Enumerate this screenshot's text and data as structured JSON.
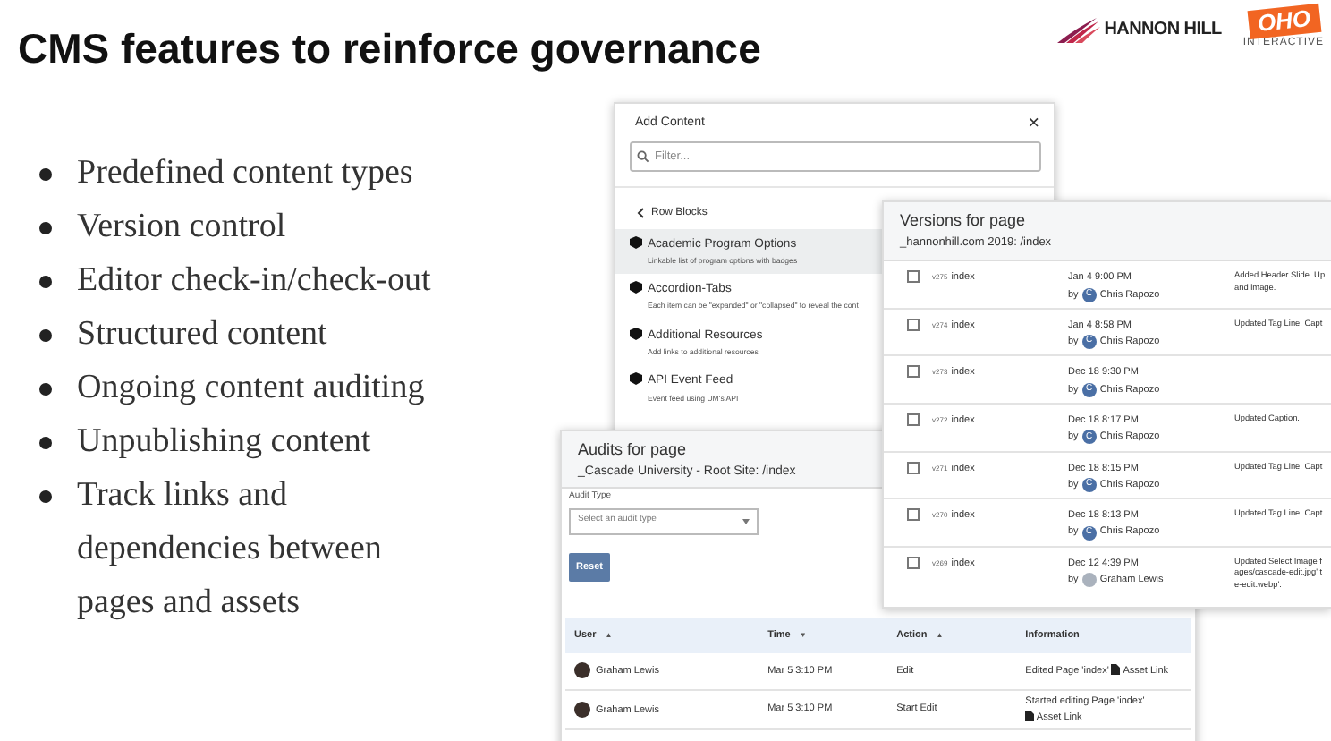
{
  "slide": {
    "title": "CMS features to reinforce governance",
    "logos": [
      {
        "kind": "hannon",
        "text": "HANNON HILL"
      },
      {
        "kind": "oho",
        "text": "OHO",
        "subtext": "INTERACTIVE"
      }
    ],
    "bullets": [
      "Predefined content types",
      "Version control",
      "Editor check-in/check-out",
      "Structured content",
      "Ongoing content auditing",
      "Unpublishing content",
      "Track links and\ndependencies between\npages and assets"
    ]
  },
  "add_content": {
    "title": "Add Content",
    "close": "×",
    "filter": {
      "placeholder": "Filter..."
    },
    "section": "Row Blocks",
    "items": [
      {
        "title": "Academic Program Options",
        "description": "Linkable list of program options with badges",
        "selected": true
      },
      {
        "title": "Accordion-Tabs",
        "description": "Each item can be \"expanded\" or \"collapsed\" to reveal the cont",
        "selected": false
      },
      {
        "title": "Additional Resources",
        "description": "Add links to additional resources",
        "selected": false
      },
      {
        "title": "API Event Feed",
        "description": "Event feed using UM's API",
        "selected": false
      }
    ]
  },
  "audits": {
    "title": "Audits for page",
    "subtitle": "_Cascade University - Root Site: /index",
    "filter_label": "Audit Type",
    "select": {
      "placeholder": "Select an audit type"
    },
    "reset": "Reset",
    "columns": [
      {
        "label": "User",
        "sort": "▲"
      },
      {
        "label": "Time",
        "sort": "▼"
      },
      {
        "label": "Action",
        "sort": "▲"
      },
      {
        "label": "Information"
      }
    ],
    "rows": [
      {
        "user": "Graham Lewis",
        "time": "Mar 5 3:10 PM",
        "action": "Edit",
        "info": "Edited Page 'index'",
        "link": "Asset Link"
      },
      {
        "user": "Graham Lewis",
        "time": "Mar 5 3:10 PM",
        "action": "Start Edit",
        "info": "Started editing Page 'index'",
        "link": "Asset Link"
      }
    ]
  },
  "versions": {
    "title": "Versions for page",
    "subtitle": "_hannonhill.com 2019: /index",
    "rows": [
      {
        "checked": false,
        "version": "v275",
        "name": "index",
        "date": "Jan 4 9:00 PM",
        "by": "by",
        "avatar": {
          "kind": "initial",
          "text": "C"
        },
        "author": "Chris Rapozo",
        "info": "Added Header Slide. Up\nand image."
      },
      {
        "checked": false,
        "version": "v274",
        "name": "index",
        "date": "Jan 4 8:58 PM",
        "by": "by",
        "avatar": {
          "kind": "initial",
          "text": "C"
        },
        "author": "Chris Rapozo",
        "info": "Updated Tag Line, Capt"
      },
      {
        "checked": false,
        "version": "v273",
        "name": "index",
        "date": "Dec 18 9:30 PM",
        "by": "by",
        "avatar": {
          "kind": "initial",
          "text": "C"
        },
        "author": "Chris Rapozo"
      },
      {
        "checked": false,
        "version": "v272",
        "name": "index",
        "date": "Dec 18 8:17 PM",
        "by": "by",
        "avatar": {
          "kind": "initial",
          "text": "C"
        },
        "author": "Chris Rapozo",
        "info": "Updated Caption."
      },
      {
        "checked": false,
        "version": "v271",
        "name": "index",
        "date": "Dec 18 8:15 PM",
        "by": "by",
        "avatar": {
          "kind": "initial",
          "text": "C"
        },
        "author": "Chris Rapozo",
        "info": "Updated Tag Line, Capt"
      },
      {
        "checked": false,
        "version": "v270",
        "name": "index",
        "date": "Dec 18 8:13 PM",
        "by": "by",
        "avatar": {
          "kind": "initial",
          "text": "C"
        },
        "author": "Chris Rapozo",
        "info": "Updated Tag Line, Capt"
      },
      {
        "checked": false,
        "version": "v269",
        "name": "index",
        "date": "Dec 12 4:39 PM",
        "by": "by",
        "avatar": {
          "kind": "photo"
        },
        "author": "Graham Lewis",
        "info": "Updated Select Image f\nages/cascade-edit.jpg' t\ne-edit.webp'."
      }
    ]
  }
}
